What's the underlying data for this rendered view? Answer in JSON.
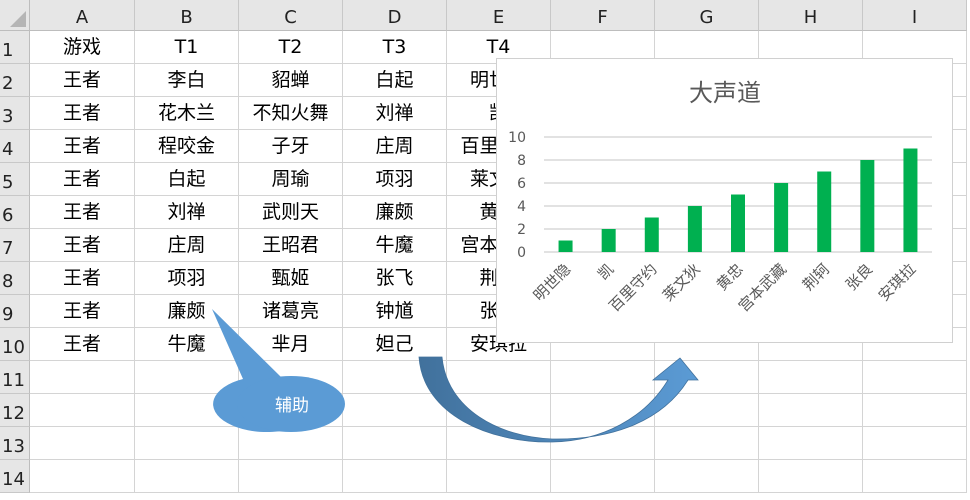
{
  "columns": [
    "A",
    "B",
    "C",
    "D",
    "E",
    "F",
    "G",
    "H",
    "I"
  ],
  "rows": [
    "1",
    "2",
    "3",
    "4",
    "5",
    "6",
    "7",
    "8",
    "9",
    "10",
    "11",
    "12",
    "13",
    "14"
  ],
  "cells": [
    [
      "游戏",
      "T1",
      "T2",
      "T3",
      "T4"
    ],
    [
      "王者",
      "李白",
      "貂蝉",
      "白起",
      "明世隐"
    ],
    [
      "王者",
      "花木兰",
      "不知火舞",
      "刘禅",
      "凯"
    ],
    [
      "王者",
      "程咬金",
      "子牙",
      "庄周",
      "百里守约"
    ],
    [
      "王者",
      "白起",
      "周瑜",
      "项羽",
      "莱文狄"
    ],
    [
      "王者",
      "刘禅",
      "武则天",
      "廉颇",
      "黄忠"
    ],
    [
      "王者",
      "庄周",
      "王昭君",
      "牛魔",
      "宫本武藏"
    ],
    [
      "王者",
      "项羽",
      "甄姬",
      "张飞",
      "荆轲"
    ],
    [
      "王者",
      "廉颇",
      "诸葛亮",
      "钟馗",
      "张良"
    ],
    [
      "王者",
      "牛魔",
      "芈月",
      "妲己",
      "安琪拉"
    ]
  ],
  "callout": {
    "text": "辅助",
    "color": "#5b9bd5"
  },
  "arrow": {
    "color_start": "#41719c",
    "color_end": "#5b9bd5"
  },
  "chart_data": {
    "type": "bar",
    "title": "大声道",
    "categories": [
      "明世隐",
      "凯",
      "百里守约",
      "莱文狄",
      "黄忠",
      "宫本武藏",
      "荆轲",
      "张良",
      "安琪拉"
    ],
    "values": [
      1,
      2,
      3,
      4,
      5,
      6,
      7,
      8,
      9
    ],
    "ylim": [
      0,
      10
    ],
    "yticks": [
      "0",
      "2",
      "4",
      "6",
      "8",
      "10"
    ],
    "xlabel": "",
    "ylabel": "",
    "grid": true,
    "bar_color": "#00b050"
  }
}
